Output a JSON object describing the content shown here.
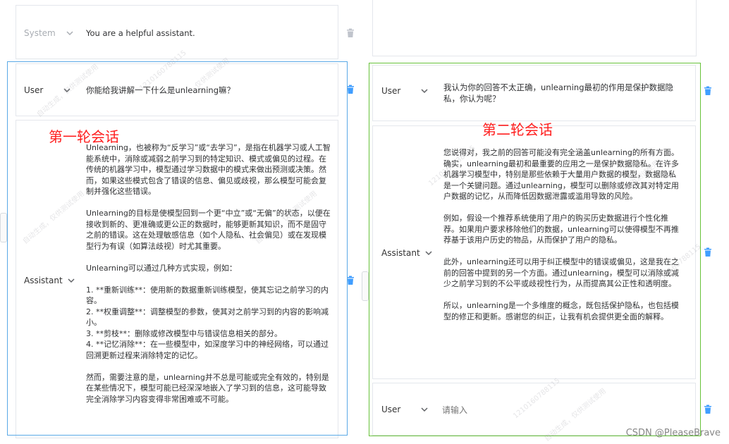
{
  "left": {
    "system": {
      "role": "System",
      "text": "You are a helpful assistant."
    },
    "user": {
      "role": "User",
      "text": "你能给我讲解一下什么是unlearning嘛？"
    },
    "assistant": {
      "role": "Assistant",
      "text": "Unlearning，也被称为“反学习”或“去学习”，是指在机器学习或人工智能系统中，消除或减弱之前学习到的特定知识、模式或偏见的过程。在传统的机器学习中，模型通过学习数据中的模式来做出预测或决策。然而，如果这些模式包含了错误的信息、偏见或歧视，那么模型可能会复制并强化这些错误。\n\nUnlearning的目标是使模型回到一个更“中立”或“无偏”的状态，以便在接收到新的、更准确或更公正的数据时，能够更新其知识，而不是固守之前的错误。这在处理敏感信息（如个人隐私、社会偏见）或在发现模型行为有误（如算法歧视）时尤其重要。\n\nUnlearning可以通过几种方式实现，例如：\n\n1. **重新训练**：使用新的数据重新训练模型，使其忘记之前学习的内容。\n2. **权重调整**：调整模型的参数，使其对之前学习到的内容的影响减小。\n3. **剪枝**：删除或修改模型中与错误信息相关的部分。\n4. **记忆消除**：在一些模型中，如深度学习中的神经网络，可以通过回溯更新过程来消除特定的记忆。\n\n然而，需要注意的是，unlearning并不总是可能或完全有效的，特别是在某些情况下，模型可能已经深深地嵌入了学习到的信息，这可能导致完全消除学习内容变得非常困难或不可能。"
    },
    "round_label": "第一轮会话"
  },
  "right": {
    "user": {
      "role": "User",
      "text": "我认为你的回答不太正确，unlearning最初的作用是保护数据隐私，你认为呢？"
    },
    "assistant": {
      "role": "Assistant",
      "text": "您说得对，我之前的回答可能没有完全涵盖unlearning的所有方面。确实，unlearning最初和最重要的应用之一是保护数据隐私。在许多机器学习模型中，特别是那些依赖于大量用户数据的模型，数据隐私是一个关键问题。通过unlearning，模型可以删除或修改其对特定用户数据的记忆，从而降低因数据泄露或滥用导致的风险。\n\n例如，假设一个推荐系统使用了用户的购买历史数据进行个性化推荐。如果用户要求移除他们的数据，unlearning可以使得模型不再推荐基于该用户历史的物品，从而保护了用户的隐私。\n\n此外，unlearning还可以用于纠正模型中的错误或偏见，这是我在之前的回答中提到的另一个方面。通过unlearning，模型可以消除或减少之前学习到的不公平或歧视性行为，从而提高其公正性和透明度。\n\n所以，unlearning是一个多维度的概念，既包括保护隐私，也包括模型的修正和更新。感谢您的纠正，让我有机会提供更全面的解释。"
    },
    "input": {
      "role": "User",
      "placeholder": "请输入"
    },
    "round_label": "第二轮会话"
  },
  "watermark": "仅供测试使用",
  "watermark_id": "1210160788115",
  "watermark_gen": "自动生成，仅供测试使用",
  "footer": "CSDN @PleaseBrave",
  "colors": {
    "frame_round1": "#5aa9e6",
    "frame_round2": "#67c23a",
    "round_label": "#ff1f1f",
    "trash_icon": "#409eff"
  }
}
